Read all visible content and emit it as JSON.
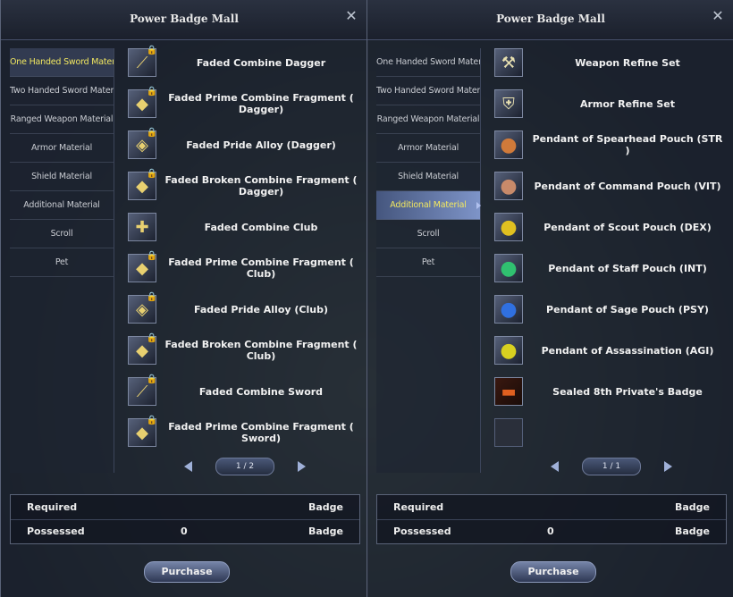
{
  "left_panel": {
    "title": "Power Badge Mall",
    "close": "✕",
    "categories": [
      {
        "label": "One Handed Sword Material"
      },
      {
        "label": "Two Handed Sword Material"
      },
      {
        "label": "Ranged Weapon Material"
      },
      {
        "label": "Armor Material"
      },
      {
        "label": "Shield Material"
      },
      {
        "label": "Additional Material"
      },
      {
        "label": "Scroll"
      },
      {
        "label": "Pet"
      }
    ],
    "items": [
      {
        "name": "Faded Combine Dagger",
        "icon": "dagger-icon",
        "glyph": "⟋"
      },
      {
        "name": "Faded Prime Combine Fragment ( Dagger)",
        "icon": "fragment-icon",
        "glyph": "◆"
      },
      {
        "name": "Faded Pride Alloy (Dagger)",
        "icon": "alloy-icon",
        "glyph": "◈"
      },
      {
        "name": "Faded Broken Combine Fragment ( Dagger)",
        "icon": "fragment-icon",
        "glyph": "◆"
      },
      {
        "name": "Faded Combine Club",
        "icon": "club-icon",
        "glyph": "✚"
      },
      {
        "name": "Faded Prime Combine Fragment ( Club)",
        "icon": "fragment-icon",
        "glyph": "◆"
      },
      {
        "name": "Faded Pride Alloy (Club)",
        "icon": "alloy-icon",
        "glyph": "◈"
      },
      {
        "name": "Faded Broken Combine Fragment ( Club)",
        "icon": "fragment-icon",
        "glyph": "◆"
      },
      {
        "name": "Faded Combine Sword",
        "icon": "sword-icon",
        "glyph": "⟋"
      },
      {
        "name": "Faded Prime Combine Fragment ( Sword)",
        "icon": "fragment-icon",
        "glyph": "◆"
      }
    ],
    "page": "1 / 2",
    "required_label": "Required",
    "required_value": "",
    "required_unit": "Badge",
    "possessed_label": "Possessed",
    "possessed_value": "0",
    "possessed_unit": "Badge",
    "purchase_label": "Purchase"
  },
  "right_panel": {
    "title": "Power Badge Mall",
    "close": "✕",
    "categories": [
      {
        "label": "One Handed Sword Material"
      },
      {
        "label": "Two Handed Sword Material"
      },
      {
        "label": "Ranged Weapon Material"
      },
      {
        "label": "Armor Material"
      },
      {
        "label": "Shield Material"
      },
      {
        "label": "Additional Material"
      },
      {
        "label": "Scroll"
      },
      {
        "label": "Pet"
      }
    ],
    "items": [
      {
        "name": "Weapon Refine Set",
        "icon": "weapon-refine-icon",
        "glyph": "⚒"
      },
      {
        "name": "Armor Refine Set",
        "icon": "armor-refine-icon",
        "glyph": "⛨"
      },
      {
        "name": "Pendant of Spearhead Pouch (STR )",
        "icon": "pouch-icon",
        "glyph": "●"
      },
      {
        "name": "Pendant of Command Pouch (VIT)",
        "icon": "pouch-icon",
        "glyph": "●"
      },
      {
        "name": "Pendant of Scout Pouch (DEX)",
        "icon": "pouch-icon",
        "glyph": "●"
      },
      {
        "name": "Pendant of Staff Pouch (INT)",
        "icon": "pouch-icon",
        "glyph": "●"
      },
      {
        "name": "Pendant of Sage Pouch (PSY)",
        "icon": "pouch-icon",
        "glyph": "●"
      },
      {
        "name": "Pendant of Assassination (AGI)",
        "icon": "pouch-icon",
        "glyph": "●"
      },
      {
        "name": "Sealed 8th Private's Badge",
        "icon": "badge-icon",
        "glyph": "▬"
      },
      {
        "name": "",
        "icon": "empty-slot-icon",
        "glyph": ""
      }
    ],
    "page": "1 / 1",
    "required_label": "Required",
    "required_value": "",
    "required_unit": "Badge",
    "possessed_label": "Possessed",
    "possessed_value": "0",
    "possessed_unit": "Badge",
    "purchase_label": "Purchase"
  },
  "colors": {
    "active_category": "#f2e860",
    "pouch_str": "#d07a3a",
    "pouch_vit": "#c88a6a",
    "pouch_dex": "#e0c020",
    "pouch_int": "#30c070",
    "pouch_psy": "#3070e0",
    "pouch_agi": "#d8d020",
    "badge": "#e06020"
  }
}
